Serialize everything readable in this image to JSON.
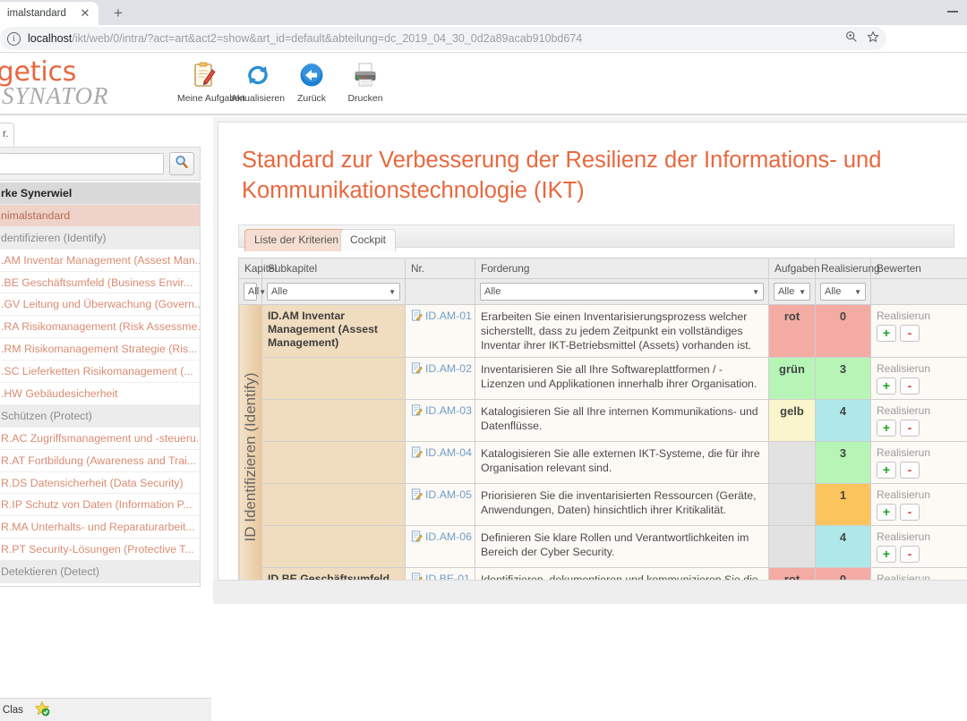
{
  "browser": {
    "tab_title": "imalstandard",
    "tab_close_icon": "close-icon",
    "new_tab_icon": "plus-icon",
    "minimize_icon": "minimize-icon",
    "url_host": "localhost",
    "url_path": "/ikt/web/0/intra/?act=art&act2=show&art_id=default&abteilung=dc_2019_04_30_0d2a89acab910bd674",
    "info_icon": "info-icon",
    "zoom_icon": "zoom-in-icon",
    "bookmark_icon": "star-icon",
    "profile_icon": "profile-avatar-icon"
  },
  "app_header": {
    "logo_line1": "nergetics",
    "logo_line2": "SYNATOR",
    "toolbar": [
      {
        "label": "Meine Aufgaben",
        "icon": "clipboard-pencil-icon"
      },
      {
        "label": "Aktualisieren",
        "icon": "refresh-icon"
      },
      {
        "label": "Zurück",
        "icon": "back-arrow-icon"
      },
      {
        "label": "Drucken",
        "icon": "printer-icon"
      }
    ]
  },
  "sidebar": {
    "tab_label": "r.",
    "search_value": "",
    "search_placeholder": "",
    "search_icon": "magnifier-icon",
    "items": [
      {
        "label": "rke Synerwiel",
        "style": "group"
      },
      {
        "label": "nimalstandard",
        "style": "selected"
      },
      {
        "label": "dentifizieren (Identify)",
        "style": "section"
      },
      {
        "label": ".AM Inventar Management (Assest Man...",
        "style": "link"
      },
      {
        "label": ".BE Geschäftsumfeld (Business Envir...",
        "style": "link"
      },
      {
        "label": ".GV Leitung und Überwachung (Govern...",
        "style": "link"
      },
      {
        "label": ".RA Risikomanagement (Risk Assessme...",
        "style": "link"
      },
      {
        "label": ".RM Risikomanagement Strategie (Ris...",
        "style": "link"
      },
      {
        "label": ".SC Lieferketten Risikomanagement (...",
        "style": "link"
      },
      {
        "label": ".HW Gebäudesicherheit",
        "style": "link"
      },
      {
        "label": "Schützen (Protect)",
        "style": "section"
      },
      {
        "label": "R.AC Zugriffsmanagement und -steueru...",
        "style": "link"
      },
      {
        "label": "R.AT Fortbildung (Awareness and Trai...",
        "style": "link"
      },
      {
        "label": "R.DS Datensicherheit (Data Security)",
        "style": "link"
      },
      {
        "label": "R.IP Schutz von Daten (Information P...",
        "style": "link"
      },
      {
        "label": "R.MA Unterhalts- und Reparaturarbeit...",
        "style": "link"
      },
      {
        "label": "R.PT Security-Lösungen (Protective T...",
        "style": "link"
      },
      {
        "label": "Detektieren (Detect)",
        "style": "section"
      }
    ],
    "status_user": "sen, Clas",
    "status_icon": "star-badge-icon"
  },
  "main": {
    "page_title": "Standard zur Verbesserung der Resilienz der Informations- und Kommunikationstechnologie (IKT)",
    "tabs": [
      {
        "label": "Liste der Kriterien",
        "active": true
      },
      {
        "label": "Cockpit",
        "active": false
      }
    ],
    "table": {
      "headers": [
        "Kapitel",
        "Subkapitel",
        "Nr.",
        "Forderung",
        "Aufgaben",
        "Realisierung",
        "Bewerten"
      ],
      "filters": {
        "kapitel": "All",
        "subkapitel": "Alle",
        "nr": "",
        "forderung": "Alle",
        "aufgaben": "Alle",
        "realisierung": "Alle",
        "bewerten": ""
      },
      "chapter_label": "ID Identifizieren (Identify)",
      "rows": [
        {
          "subkapitel": "ID.AM Inventar Management (Assest Management)",
          "nr": "ID.AM-01",
          "icon": "document-edit-icon",
          "forderung": "Erarbeiten Sie einen Inventarisierungsprozess welcher sicherstellt, dass zu jedem Zeitpunkt ein vollständiges Inventar ihrer IKT-Betriebsmittel (Assets) vorhanden ist.",
          "aufgaben": "rot",
          "aufgaben_color": "#f4aba4",
          "realisierung": "0",
          "realisierung_color": "#f4aba4",
          "bewerten_label": "Realisierun",
          "plus": "+",
          "minus": "-"
        },
        {
          "subkapitel": "",
          "nr": "ID.AM-02",
          "icon": "document-edit-icon",
          "forderung": "Inventarisieren Sie all Ihre Softwareplattformen / -Lizenzen und Applikationen innerhalb ihrer Organisation.",
          "aufgaben": "grün",
          "aufgaben_color": "#b6f5b6",
          "realisierung": "3",
          "realisierung_color": "#b6f5b6",
          "bewerten_label": "Realisierun",
          "plus": "+",
          "minus": "-"
        },
        {
          "subkapitel": "",
          "nr": "ID.AM-03",
          "icon": "document-edit-icon",
          "forderung": "Katalogisieren Sie all Ihre internen Kommunikations- und Datenflüsse.",
          "aufgaben": "gelb",
          "aufgaben_color": "#fbf5cd",
          "realisierung": "4",
          "realisierung_color": "#aee8e8",
          "bewerten_label": "Realisierun",
          "plus": "+",
          "minus": "-"
        },
        {
          "subkapitel": "",
          "nr": "ID.AM-04",
          "icon": "document-edit-icon",
          "forderung": "Katalogisieren Sie alle externen IKT-Systeme, die für ihre Organisation relevant sind.",
          "aufgaben": "",
          "aufgaben_color": "#e2e2e2",
          "realisierung": "3",
          "realisierung_color": "#b6f5b6",
          "bewerten_label": "Realisierun",
          "plus": "+",
          "minus": "-"
        },
        {
          "subkapitel": "",
          "nr": "ID.AM-05",
          "icon": "document-edit-icon",
          "forderung": "Priorisieren Sie die inventarisierten Ressourcen (Geräte, Anwendungen, Daten) hinsichtlich ihrer Kritikalität.",
          "aufgaben": "",
          "aufgaben_color": "#e2e2e2",
          "realisierung": "1",
          "realisierung_color": "#fcc45c",
          "bewerten_label": "Realisierun",
          "plus": "+",
          "minus": "-"
        },
        {
          "subkapitel": "",
          "nr": "ID.AM-06",
          "icon": "document-edit-icon",
          "forderung": "Definieren Sie klare Rollen und Verantwortlichkeiten im Bereich der Cyber Security.",
          "aufgaben": "",
          "aufgaben_color": "#e2e2e2",
          "realisierung": "4",
          "realisierung_color": "#aee8e8",
          "bewerten_label": "Realisierun",
          "plus": "+",
          "minus": "-"
        },
        {
          "subkapitel": "ID.BE Geschäftsumfeld (Business Environment)",
          "nr": "ID.BE-01",
          "icon": "document-edit-icon",
          "forderung": "Identifizieren, dokumentieren und kommunizieren Sie die Rolle ihres Unternehmens innerhalb der (kritischen)",
          "aufgaben": "rot",
          "aufgaben_color": "#f4aba4",
          "realisierung": "0",
          "realisierung_color": "#f4aba4",
          "bewerten_label": "Realisierun",
          "plus": "+",
          "minus": "-"
        }
      ]
    }
  },
  "colors": {
    "accent": "#e8683e",
    "chapter_gradient_start": "#f3e3cb",
    "chapter_gradient_end": "#e8c79b",
    "subchapter_bg": "#f0dcbe",
    "selected_nav": "#f0d3c8"
  }
}
